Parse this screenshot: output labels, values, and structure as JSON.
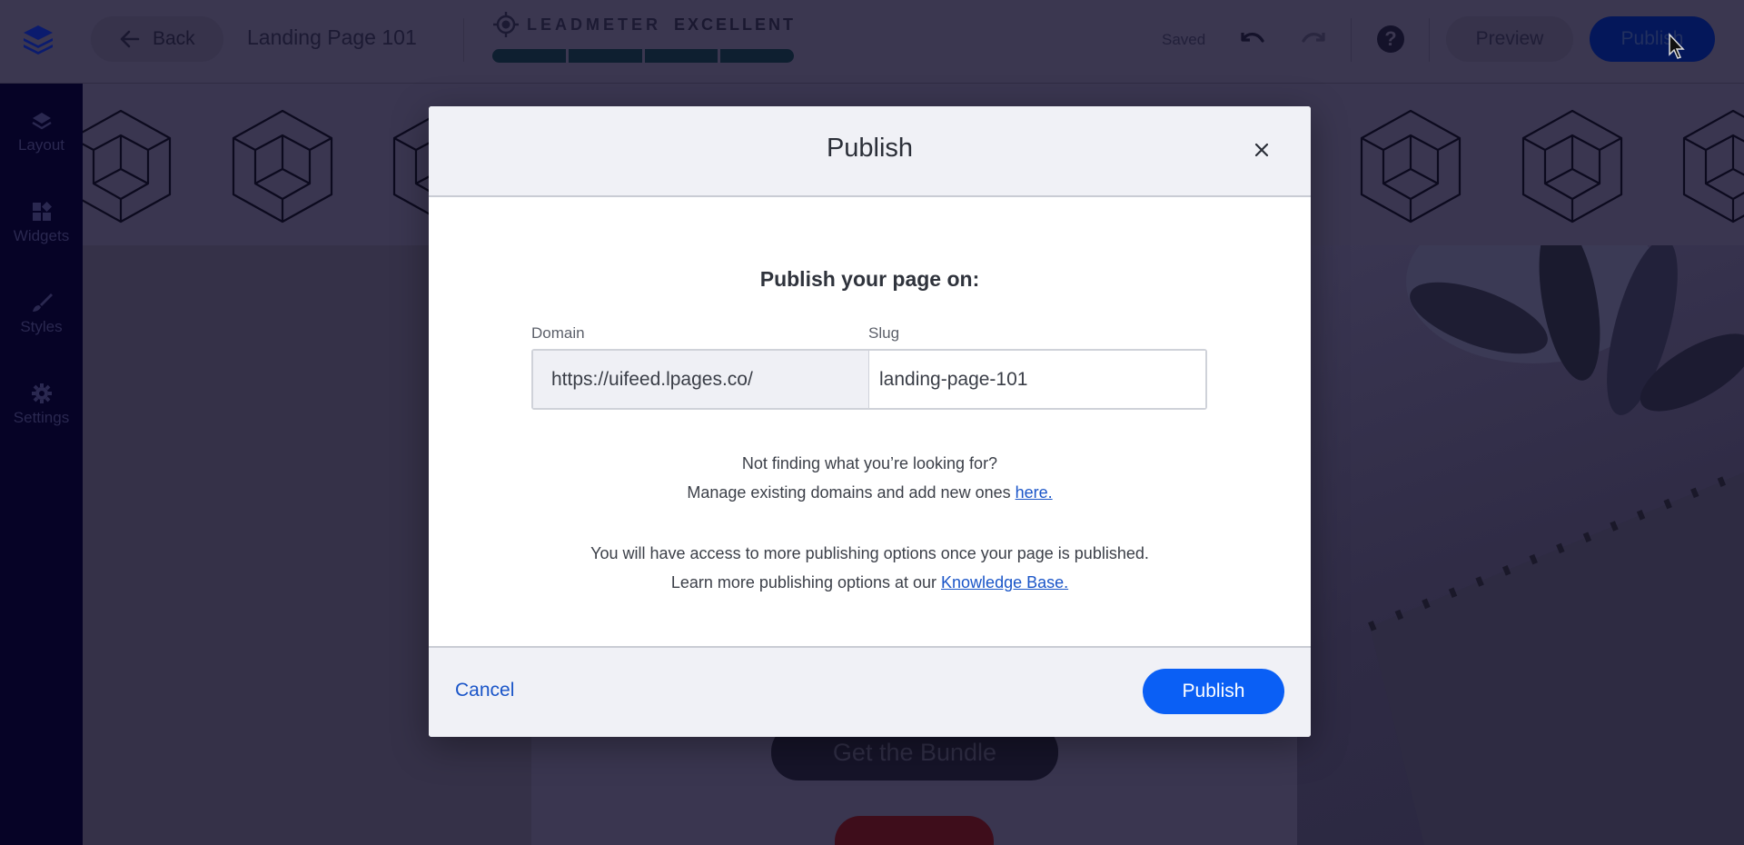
{
  "topbar": {
    "logo_icon": "layers-logo-icon",
    "back_label": "Back",
    "page_name": "Landing Page 101",
    "leadmeter": {
      "label": "LEADMETER",
      "rating": "EXCELLENT",
      "segments_filled": 4,
      "segments_total": 4,
      "bar_color": "#0e1f30"
    },
    "saved_status": "Saved",
    "undo_icon": "undo-icon",
    "redo_icon": "redo-icon",
    "help_icon": "help-icon",
    "help_glyph": "?",
    "preview_label": "Preview",
    "publish_label": "Publish"
  },
  "sidebar": {
    "items": [
      {
        "label": "Layout",
        "icon": "layers-icon"
      },
      {
        "label": "Widgets",
        "icon": "widgets-icon"
      },
      {
        "label": "Styles",
        "icon": "brush-icon"
      },
      {
        "label": "Settings",
        "icon": "gear-icon"
      }
    ]
  },
  "canvas": {
    "cta_label": "Get the Bundle"
  },
  "modal": {
    "title": "Publish",
    "close_icon": "close-icon",
    "heading": "Publish your page on:",
    "domain_label": "Domain",
    "domain_value": "https://uifeed.lpages.co/",
    "slug_label": "Slug",
    "slug_value": "landing-page-101",
    "help_line1": "Not finding what you’re looking for?",
    "help_line2_text": "Manage existing domains and add new ones ",
    "help_line2_link": "here.",
    "info_line1": "You will have access to more publishing options once your page is published.",
    "info_line2_text": "Learn more publishing options at our ",
    "info_line2_link": "Knowledge Base.",
    "cancel_label": "Cancel",
    "publish_label": "Publish",
    "accent_color": "#0a5ff5",
    "link_color": "#1a55c8"
  }
}
